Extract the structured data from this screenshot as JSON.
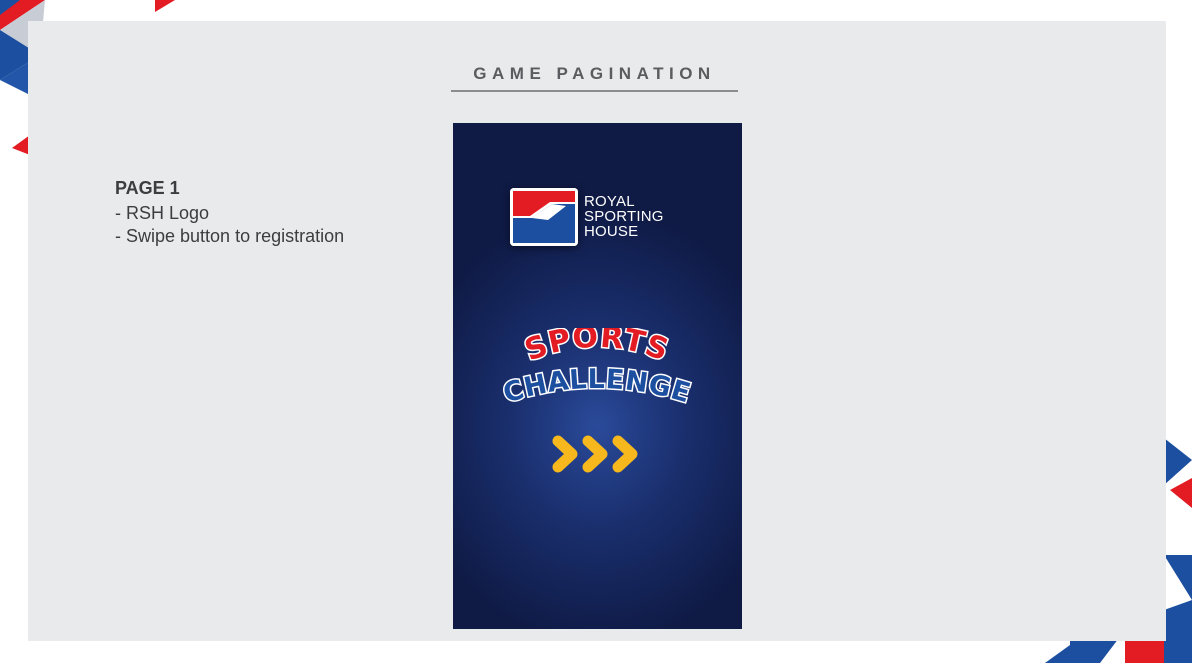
{
  "header": {
    "title": "GAME PAGINATION"
  },
  "notes": {
    "page_label": "PAGE 1",
    "items": [
      "- RSH Logo",
      "- Swipe button to registration"
    ]
  },
  "screen": {
    "logo": {
      "lines": [
        "ROYAL",
        "SPORTING",
        "HOUSE"
      ]
    },
    "game_title": {
      "line1": "SPORTS",
      "line2": "CHALLENGE"
    },
    "swipe_button_icon": "triple-chevron-right-icon"
  },
  "colors": {
    "brand_red": "#e31b23",
    "brand_blue": "#1c4fa0",
    "panel_bg": "#e9eaec",
    "arrow_yellow": "#f6b81c"
  }
}
